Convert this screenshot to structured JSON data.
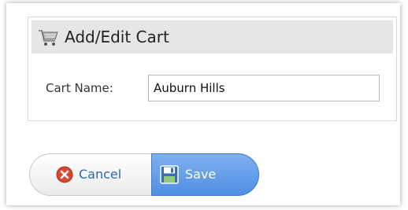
{
  "panel": {
    "title": "Add/Edit Cart",
    "icon": "cart-icon"
  },
  "form": {
    "cart_name_label": "Cart Name:",
    "cart_name_value": "Auburn Hills"
  },
  "buttons": {
    "cancel_label": "Cancel",
    "cancel_icon": "cancel-x-icon",
    "save_label": "Save",
    "save_icon": "floppy-disk-icon"
  },
  "colors": {
    "save_button": "#5a96e6",
    "cancel_icon": "#d9472b",
    "cancel_text": "#2a67b8"
  }
}
